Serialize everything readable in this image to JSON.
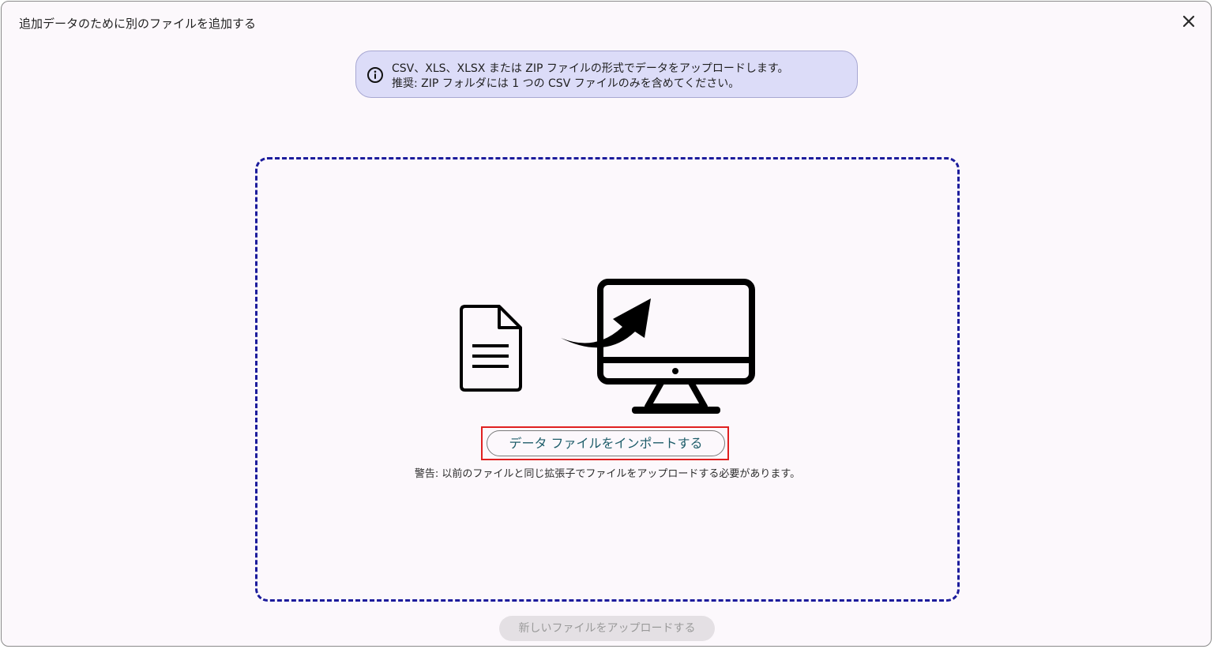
{
  "dialog": {
    "title": "追加データのために別のファイルを追加する",
    "close_icon": "close-icon"
  },
  "info_banner": {
    "icon": "info-icon",
    "line1": "CSV、XLS、XLSX または ZIP ファイルの形式でデータをアップロードします。",
    "line2": "推奨: ZIP フォルダには 1 つの CSV ファイルのみを含めてください。"
  },
  "dropzone": {
    "illustration_icons": [
      "document-icon",
      "arrow-icon",
      "monitor-icon"
    ],
    "import_button_label": "データ ファイルをインポートする",
    "warning": "警告: 以前のファイルと同じ拡張子でファイルをアップロードする必要があります。"
  },
  "footer": {
    "upload_button_label": "新しいファイルをアップロードする",
    "upload_button_enabled": false
  },
  "colors": {
    "dropzone_border": "#1c1c9c",
    "info_background": "#dcdcf8",
    "highlight": "#e02020",
    "button_text": "#1e5d6a"
  }
}
